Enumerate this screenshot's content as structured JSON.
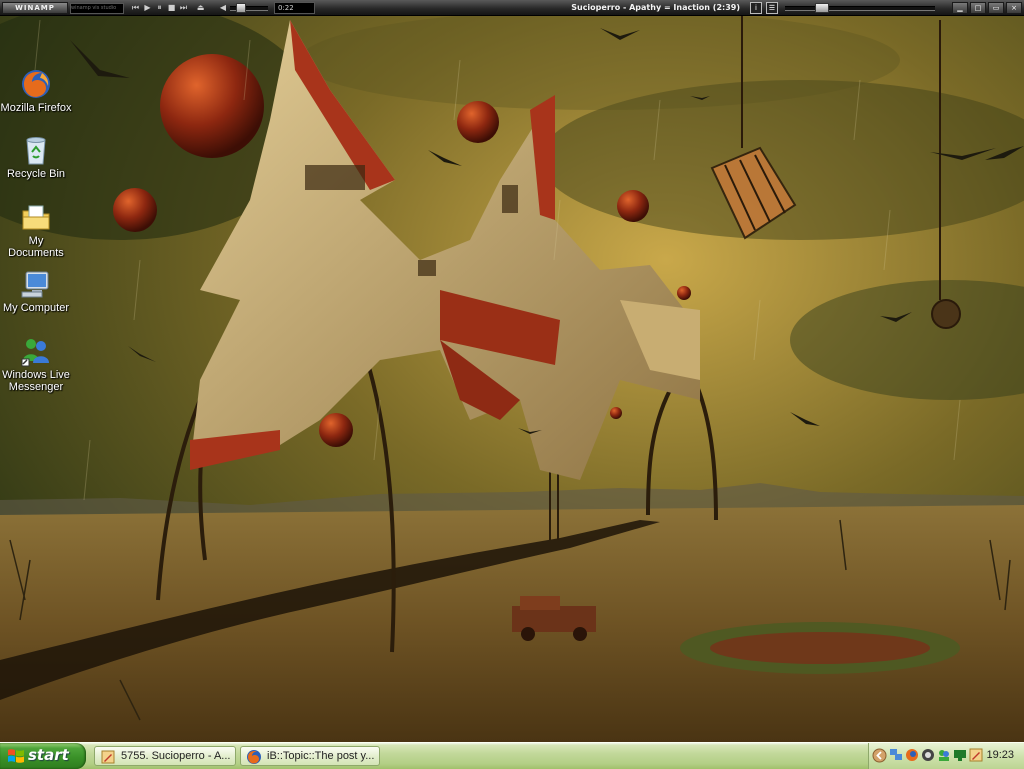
{
  "winamp": {
    "logo": "WINAMP",
    "visualizer_text": "winamp vis studio",
    "elapsed_time": "0:22",
    "track_title": "Sucioperro - Apathy = Inaction (2:39)",
    "volume_level": 0.15,
    "seek_level": 0.2
  },
  "desktop": {
    "icons": [
      {
        "label": "Mozilla Firefox",
        "icon": "firefox-icon"
      },
      {
        "label": "Recycle Bin",
        "icon": "recycle-bin-icon"
      },
      {
        "label": "My Documents",
        "icon": "my-documents-icon"
      },
      {
        "label": "My Computer",
        "icon": "my-computer-icon"
      },
      {
        "label": "Windows Live Messenger",
        "icon": "messenger-icon"
      }
    ],
    "colors": {
      "sky_top": "#2d3614",
      "sky_glow": "#c8a347",
      "ground": "#7a5c27",
      "building": "#d7c08a",
      "building_red": "#a8341b",
      "sphere": "#8e2b12"
    }
  },
  "taskbar": {
    "start_label": "start",
    "tasks": [
      {
        "title": "5755. Sucioperro - A...",
        "icon": "pencil-icon"
      },
      {
        "title": "iB::Topic::The post y...",
        "icon": "firefox-icon"
      }
    ],
    "clock": "19:23"
  }
}
